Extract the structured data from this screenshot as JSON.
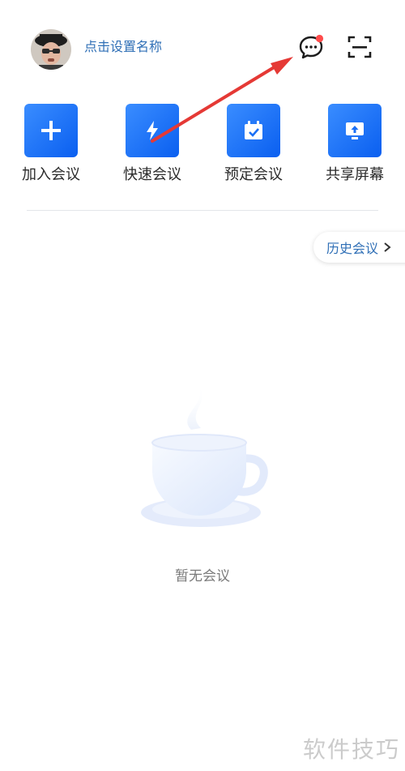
{
  "header": {
    "username": "点击设置名称",
    "avatar_icon": "user-avatar",
    "message_icon": "message-bubble-icon",
    "scan_icon": "scan-icon",
    "notification_dot_color": "#ff4b4b"
  },
  "quick_actions": [
    {
      "label": "加入会议",
      "icon": "plus-icon"
    },
    {
      "label": "快速会议",
      "icon": "lightning-icon"
    },
    {
      "label": "预定会议",
      "icon": "calendar-check-icon"
    },
    {
      "label": "共享屏幕",
      "icon": "share-screen-icon"
    }
  ],
  "history": {
    "label": "历史会议"
  },
  "empty_state": {
    "text": "暂无会议",
    "icon": "coffee-cup-illustration"
  },
  "watermark": "软件技巧",
  "colors": {
    "accent": "#1a6ff5",
    "link_text": "#2f6fb6",
    "annotation_arrow": "#e53935"
  }
}
